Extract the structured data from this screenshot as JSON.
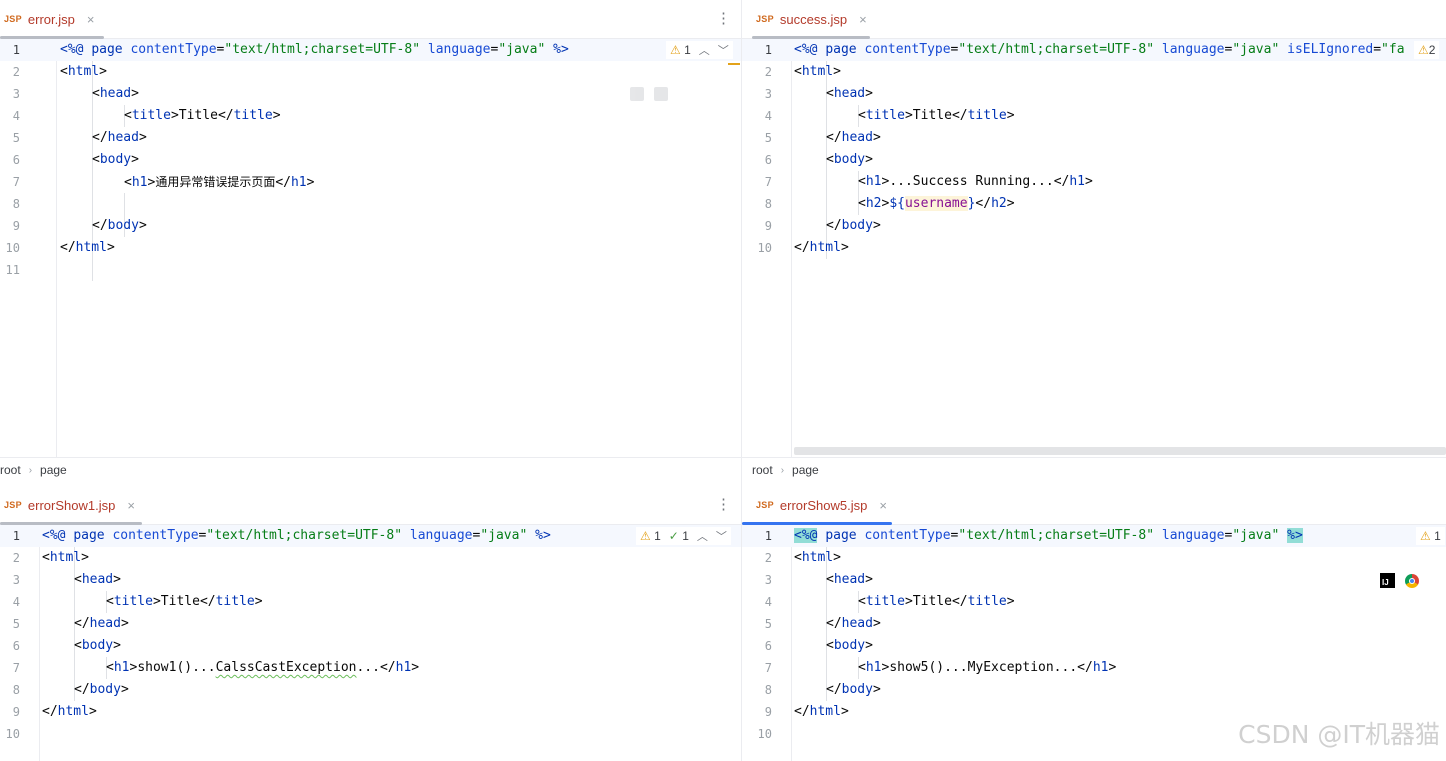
{
  "panes": [
    {
      "tab": {
        "icon": "JSP",
        "name": "error.jsp",
        "close": "×"
      },
      "more": "⋮",
      "inspections": {
        "warnings": "1",
        "checks": ""
      },
      "breadcrumb": [
        "root",
        "page"
      ],
      "line_numbers": [
        "1",
        "2",
        "3",
        "4",
        "5",
        "6",
        "7",
        "8",
        "9",
        "10",
        "11"
      ]
    },
    {
      "tab": {
        "icon": "JSP",
        "name": "success.jsp",
        "close": "×"
      },
      "inspections": {
        "warnings": "2",
        "checks": ""
      },
      "breadcrumb": [
        "root",
        "page"
      ],
      "line_numbers": [
        "1",
        "2",
        "3",
        "4",
        "5",
        "6",
        "7",
        "8",
        "9",
        "10"
      ]
    },
    {
      "tab": {
        "icon": "JSP",
        "name": "errorShow1.jsp",
        "close": "×"
      },
      "more": "⋮",
      "inspections": {
        "warnings": "1",
        "checks": "1"
      },
      "line_numbers": [
        "1",
        "2",
        "3",
        "4",
        "5",
        "6",
        "7",
        "8",
        "9",
        "10"
      ]
    },
    {
      "tab": {
        "icon": "JSP",
        "name": "errorShow5.jsp",
        "close": "×"
      },
      "inspections": {
        "warnings": "1",
        "checks": ""
      },
      "line_numbers": [
        "1",
        "2",
        "3",
        "4",
        "5",
        "6",
        "7",
        "8",
        "9",
        "10"
      ]
    }
  ],
  "code": {
    "directive_open": "<%@",
    "directive_close": "%>",
    "kw_page": "page",
    "attr_contentType": "contentType",
    "attr_language": "language",
    "attr_isELIgnored": "isELIgnored",
    "val_contentType": "\"text/html;charset=UTF-8\"",
    "val_language": "\"java\"",
    "val_isELIgnored_cut": "\"fa",
    "eq": "=",
    "html": "html",
    "head": "head",
    "title": "title",
    "body": "body",
    "h1": "h1",
    "h2": "h2",
    "title_text": "Title",
    "error_h1_text": "通用异常错误提示页面",
    "success_h1_text": "...Success Running...",
    "el_open": "${",
    "el_var": "username",
    "el_close": "}",
    "show1_prefix": "show1()...",
    "show1_exception": "CalssCastException",
    "show1_suffix": "...",
    "show5_text": "show5()...MyException..."
  },
  "icons": {
    "warning": "⚠",
    "check": "✓",
    "chevron_up": "︿",
    "chevron_down": "﹀",
    "breadcrumb_sep": "›",
    "ij_label": "IJ"
  },
  "watermark": "CSDN @IT机器猫"
}
